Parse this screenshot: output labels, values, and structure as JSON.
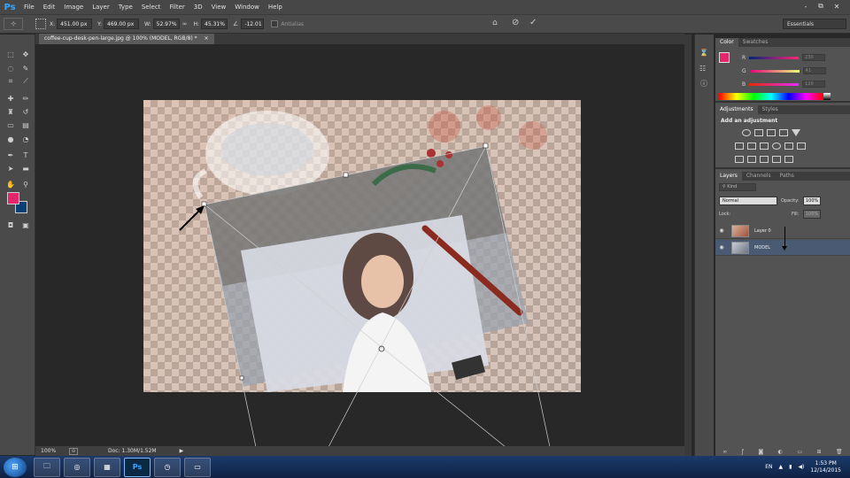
{
  "app": {
    "logo": "Ps"
  },
  "menu": [
    "File",
    "Edit",
    "Image",
    "Layer",
    "Type",
    "Select",
    "Filter",
    "3D",
    "View",
    "Window",
    "Help"
  ],
  "window_controls": {
    "minimize": "-",
    "restore": "⧉",
    "close": "✕"
  },
  "options_bar": {
    "x_label": "X:",
    "x_value": "451.00 px",
    "y_label": "Y:",
    "y_value": "469.00 px",
    "w_label": "W:",
    "w_value": "52.97%",
    "h_label": "H:",
    "h_value": "45.31%",
    "angle_value": "-12.01",
    "antialias_label": "Antialias",
    "workspace": "Essentials"
  },
  "document": {
    "tab_title": "coffee-cup-desk-pen-large.jpg @ 100% (MODEL, RGB/8) *",
    "close_glyph": "×",
    "zoom": "100%",
    "doc_info": "Doc: 1.30M/1.52M"
  },
  "tools": {
    "primary_color": "#e5256c",
    "secondary_color": "#0a3f73"
  },
  "color_panel": {
    "tabs": [
      "Color",
      "Swatches"
    ],
    "channels": [
      {
        "label": "R",
        "value": "230"
      },
      {
        "label": "G",
        "value": "41"
      },
      {
        "label": "B",
        "value": "120"
      }
    ]
  },
  "adjustments_panel": {
    "tabs": [
      "Adjustments",
      "Styles"
    ],
    "heading": "Add an adjustment"
  },
  "layers_panel": {
    "tabs": [
      "Layers",
      "Channels",
      "Paths"
    ],
    "kind_filter": "Kind",
    "blend_mode": "Normal",
    "opacity_label": "Opacity:",
    "opacity_value": "100%",
    "lock_label": "Lock:",
    "fill_label": "Fill:",
    "fill_value": "100%",
    "layers": [
      {
        "name": "Layer 0",
        "selected": false
      },
      {
        "name": "MODEL",
        "selected": true
      }
    ]
  },
  "taskbar": {
    "language": "EN",
    "time": "1:53 PM",
    "date": "12/14/2015",
    "apps": [
      "explorer-icon",
      "chrome-icon",
      "folder-icon",
      "photoshop-icon",
      "media-icon",
      "image-viewer-icon"
    ]
  }
}
